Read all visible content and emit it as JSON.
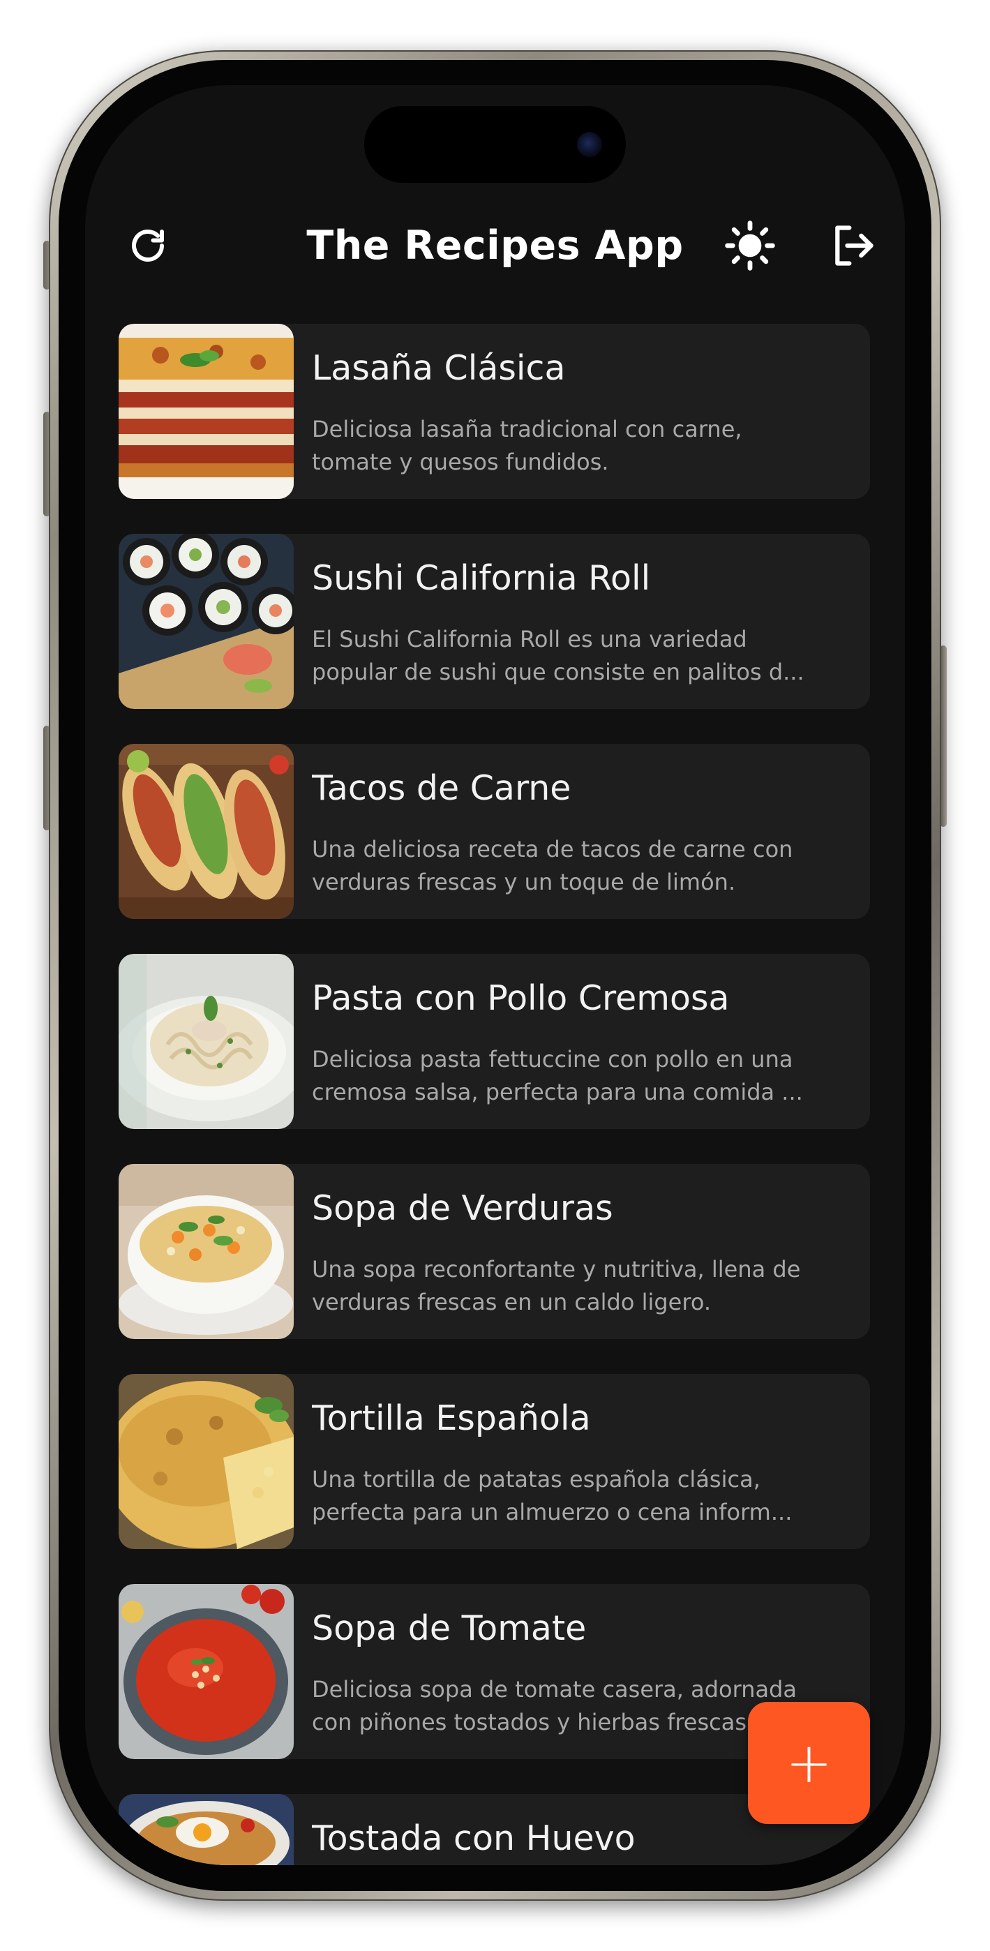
{
  "app": {
    "title": "The Recipes App"
  },
  "header": {
    "refresh_icon": "refresh-icon",
    "theme_icon": "sun-icon",
    "logout_icon": "logout-icon"
  },
  "recipes": [
    {
      "title": "Lasaña Clásica",
      "description_lines": [
        "Deliciosa lasaña tradicional con carne,",
        "tomate y quesos fundidos."
      ],
      "image_icon": "lasagna-image"
    },
    {
      "title": "Sushi California Roll",
      "description_lines": [
        "El Sushi California Roll es una variedad",
        "popular de sushi que consiste en palitos d..."
      ],
      "image_icon": "sushi-image"
    },
    {
      "title": "Tacos de Carne",
      "description_lines": [
        "Una deliciosa receta de tacos de carne con",
        "verduras frescas y un toque de limón."
      ],
      "image_icon": "tacos-image"
    },
    {
      "title": "Pasta con Pollo Cremosa",
      "description_lines": [
        "Deliciosa pasta fettuccine con pollo en una",
        "cremosa salsa, perfecta para una comida ..."
      ],
      "image_icon": "pasta-image"
    },
    {
      "title": "Sopa de Verduras",
      "description_lines": [
        "Una sopa reconfortante y nutritiva, llena de",
        "verduras frescas en un caldo ligero."
      ],
      "image_icon": "vegetable-soup-image"
    },
    {
      "title": "Tortilla Española",
      "description_lines": [
        "Una tortilla de patatas española clásica,",
        "perfecta para un almuerzo o cena inform..."
      ],
      "image_icon": "tortilla-image"
    },
    {
      "title": "Sopa de Tomate",
      "description_lines": [
        "Deliciosa sopa de tomate casera, adornada",
        "con piñones tostados y hierbas frescas."
      ],
      "image_icon": "tomato-soup-image"
    },
    {
      "title": "Tostada con Huevo",
      "description_lines": [],
      "image_icon": "toast-egg-image"
    }
  ],
  "fab": {
    "label": "+",
    "icon": "plus-icon",
    "color": "#ff5722"
  },
  "colors": {
    "background": "#111111",
    "card": "#1e1e1e",
    "title_text": "#f2f2f2",
    "description_text": "#a9a9a9",
    "accent": "#ff5722"
  }
}
